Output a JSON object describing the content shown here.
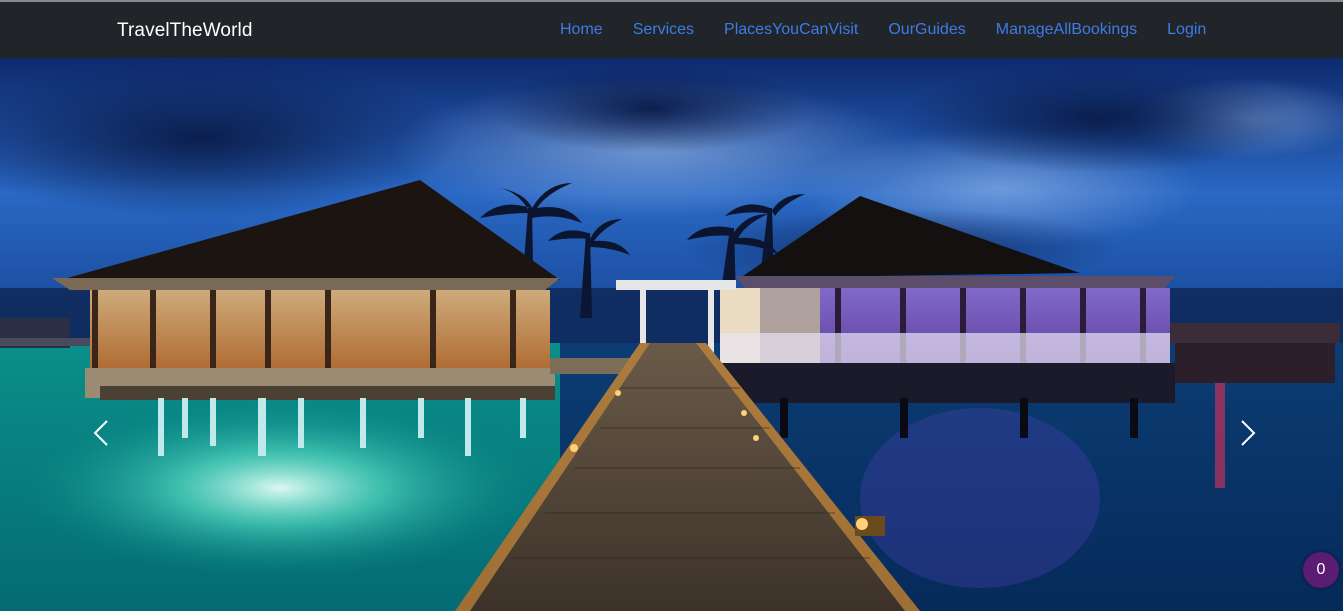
{
  "navbar": {
    "brand": "TravelTheWorld",
    "links": [
      {
        "label": "Home"
      },
      {
        "label": "Services"
      },
      {
        "label": "PlacesYouCanVisit"
      },
      {
        "label": "OurGuides"
      },
      {
        "label": "ManageAllBookings"
      },
      {
        "label": "Login"
      }
    ]
  },
  "carousel": {
    "image_subject": "overwater-resort-at-night",
    "prev_icon": "chevron-left-icon",
    "next_icon": "chevron-right-icon"
  },
  "cart_badge": {
    "count": "0"
  },
  "colors": {
    "navbar_bg": "#212529",
    "nav_link": "#3d7be6",
    "brand_text": "#ffffff",
    "badge_bg": "#5b1c73"
  }
}
